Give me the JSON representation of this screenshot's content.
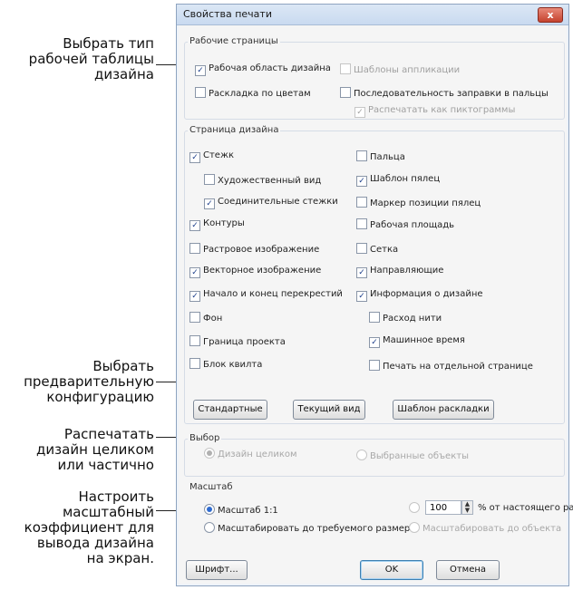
{
  "callouts": {
    "workspace_type": [
      "Выбрать тип",
      "рабочей таблицы",
      "дизайна"
    ],
    "preset_config": [
      "Выбрать",
      "предварительную",
      "конфигурацию"
    ],
    "print_whole": [
      "Распечатать",
      "дизайн целиком",
      "или частично"
    ],
    "scale": [
      "Настроить",
      "масштабный",
      "коэффициент для",
      "вывода дизайна",
      "на экран."
    ]
  },
  "dialog": {
    "title": "Свойства печати",
    "close_label": "x",
    "work_pages": {
      "label": "Рабочие страницы",
      "design_workspace": {
        "label": "Рабочая область дизайна",
        "checked": true
      },
      "app_templates": {
        "label": "Шаблоны аппликации",
        "checked": false,
        "disabled": true
      },
      "color_layout": {
        "label": "Раскладка по цветам",
        "checked": false
      },
      "finger_sequence": {
        "label": "Последовательность заправки в пальцы",
        "checked": false
      },
      "print_as_pictograms": {
        "label": "Распечатать как пиктограммы",
        "checked": true,
        "disabled": true
      }
    },
    "design_page": {
      "label": "Страница дизайна",
      "left": [
        {
          "label": "Стежк",
          "checked": true
        },
        {
          "label": "Художественный вид",
          "checked": false
        },
        {
          "label": "Соединительные стежки",
          "checked": true
        },
        {
          "label": "Контуры",
          "checked": true
        },
        {
          "label": "Растровое изображение",
          "checked": false
        },
        {
          "label": "Векторное изображение",
          "checked": true
        },
        {
          "label": "Начало и конец перекрестий",
          "checked": true
        },
        {
          "label": "Фон",
          "checked": false
        },
        {
          "label": "Граница проекта",
          "checked": false
        },
        {
          "label": "Блок квилта",
          "checked": false
        }
      ],
      "right": [
        {
          "label": "Пальца",
          "checked": false
        },
        {
          "label": "Шаблон пялец",
          "checked": true
        },
        {
          "label": "Маркер позиции пялец",
          "checked": false
        },
        {
          "label": "Рабочая площадь",
          "checked": false
        },
        {
          "label": "Сетка",
          "checked": false
        },
        {
          "label": "Направляющие",
          "checked": true
        },
        {
          "label": "Информация о дизайне",
          "checked": true
        },
        {
          "label": "Расход нити",
          "checked": false
        },
        {
          "label": "Машинное время",
          "checked": true
        },
        {
          "label": "Печать на отдельной странице",
          "checked": false
        }
      ],
      "buttons": {
        "standard": "Стандартные",
        "current_view": "Текущий вид",
        "layout_template": "Шаблон раскладки"
      }
    },
    "selection": {
      "label": "Выбор",
      "whole_design": "Дизайн целиком",
      "selected_objects": "Выбранные объекты"
    },
    "scale": {
      "label": "Масштаб",
      "scale_1_1": "Масштаб 1:1",
      "percent_value": "100",
      "percent_suffix": "% от настоящего раз",
      "fit_size": "Масштабировать до требуемого размера",
      "fit_object": "Масштабировать до объекта"
    },
    "footer": {
      "font_button": "Шрифт...",
      "ok_button": "OK",
      "cancel_button": "Отмена"
    }
  },
  "colors": {
    "accent": "#2e6bd0",
    "close": "#c5432f"
  }
}
